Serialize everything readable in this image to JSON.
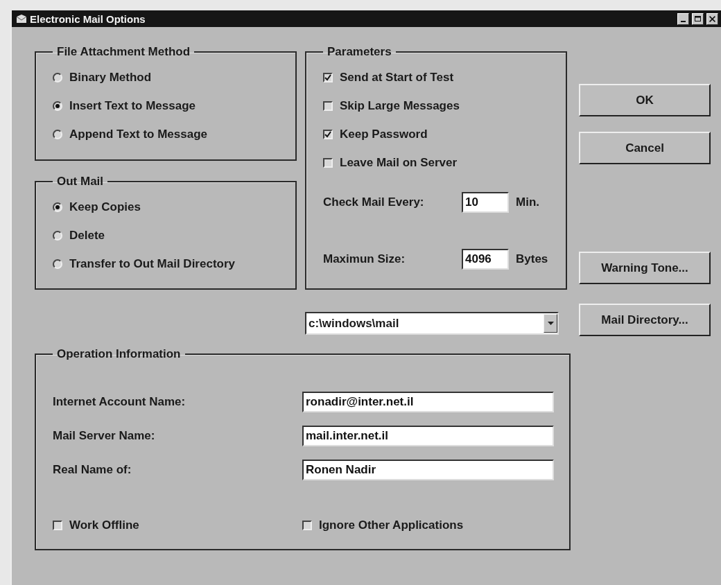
{
  "window": {
    "title": "Electronic Mail Options"
  },
  "file_attachment_method": {
    "title": "File Attachment Method",
    "options": [
      {
        "label": "Binary Method",
        "selected": false
      },
      {
        "label": "Insert Text to Message",
        "selected": true
      },
      {
        "label": "Append Text to Message",
        "selected": false
      }
    ]
  },
  "out_mail": {
    "title": "Out Mail",
    "options": [
      {
        "label": "Keep Copies",
        "selected": true
      },
      {
        "label": "Delete",
        "selected": false
      },
      {
        "label": "Transfer to Out Mail Directory",
        "selected": false
      }
    ]
  },
  "parameters": {
    "title": "Parameters",
    "checkboxes": [
      {
        "label": "Send at Start of Test",
        "checked": true
      },
      {
        "label": "Skip Large Messages",
        "checked": false
      },
      {
        "label": "Keep Password",
        "checked": true
      },
      {
        "label": "Leave Mail on Server",
        "checked": false
      }
    ],
    "check_mail_every": {
      "label": "Check Mail Every:",
      "value": "10",
      "unit": "Min."
    },
    "maximum_size": {
      "label": "Maximun Size:",
      "value": "4096",
      "unit": "Bytes"
    }
  },
  "mail_directory": {
    "value": "c:\\windows\\mail"
  },
  "buttons": [
    "OK",
    "Cancel",
    "Warning Tone...",
    "Mail Directory..."
  ],
  "operation_information": {
    "title": "Operation Information",
    "fields": [
      {
        "label": "Internet Account Name:",
        "value": "ronadir@inter.net.il"
      },
      {
        "label": "Mail Server Name:",
        "value": "mail.inter.net.il"
      },
      {
        "label": "Real Name of:",
        "value": "Ronen Nadir"
      }
    ],
    "checkboxes": [
      {
        "label": "Work Offline",
        "checked": false
      },
      {
        "label": "Ignore Other Applications",
        "checked": false
      }
    ]
  }
}
